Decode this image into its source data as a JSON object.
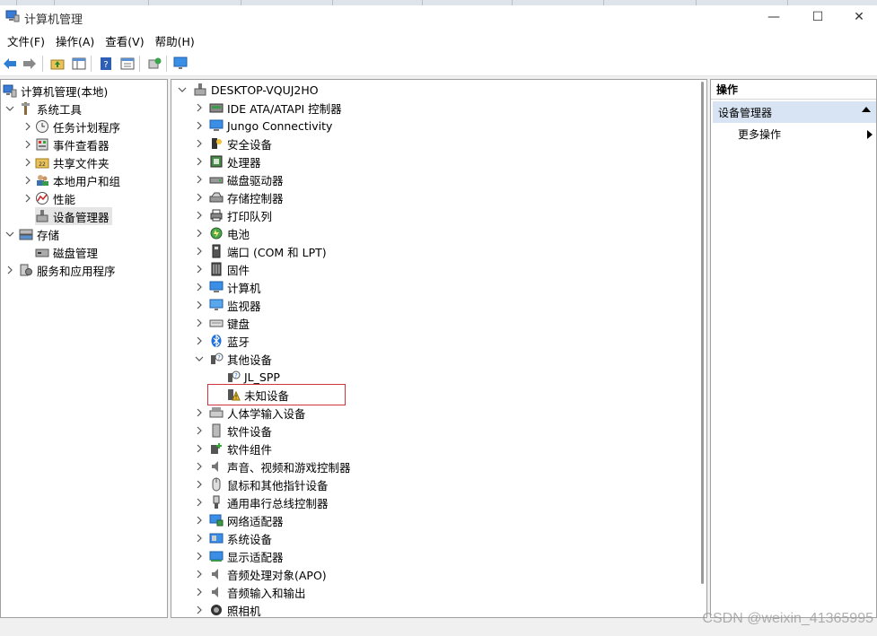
{
  "window": {
    "title": "计算机管理"
  },
  "menu": [
    "文件(F)",
    "操作(A)",
    "查看(V)",
    "帮助(H)"
  ],
  "toolbar_icons": [
    "back-arrow-icon",
    "forward-arrow-icon",
    "up-folder-icon",
    "show-hide-tree-icon",
    "help-icon",
    "properties-icon",
    "update-driver-icon",
    "monitor-icon"
  ],
  "left_tree": [
    {
      "label": "计算机管理(本地)",
      "icon": "computer-management-icon",
      "level": 0,
      "chevron": "",
      "selected": false
    },
    {
      "label": "系统工具",
      "icon": "tools-icon",
      "level": 0,
      "chevron": "down",
      "selected": false
    },
    {
      "label": "任务计划程序",
      "icon": "clock-icon",
      "level": 1,
      "chevron": "right",
      "selected": false
    },
    {
      "label": "事件查看器",
      "icon": "event-viewer-icon",
      "level": 1,
      "chevron": "right",
      "selected": false
    },
    {
      "label": "共享文件夹",
      "icon": "shared-folder-icon",
      "level": 1,
      "chevron": "right",
      "selected": false
    },
    {
      "label": "本地用户和组",
      "icon": "users-icon",
      "level": 1,
      "chevron": "right",
      "selected": false
    },
    {
      "label": "性能",
      "icon": "performance-icon",
      "level": 1,
      "chevron": "right",
      "selected": false
    },
    {
      "label": "设备管理器",
      "icon": "device-manager-icon",
      "level": 1,
      "chevron": "",
      "selected": true
    },
    {
      "label": "存储",
      "icon": "storage-icon",
      "level": 0,
      "chevron": "down",
      "selected": false
    },
    {
      "label": "磁盘管理",
      "icon": "disk-management-icon",
      "level": 1,
      "chevron": "",
      "selected": false
    },
    {
      "label": "服务和应用程序",
      "icon": "services-icon",
      "level": 0,
      "chevron": "right",
      "selected": false
    }
  ],
  "device_tree": {
    "root": "DESKTOP-VQUJ2HO",
    "items": [
      {
        "label": "IDE ATA/ATAPI 控制器",
        "icon": "ide-controller-icon",
        "level": 1,
        "chevron": "right"
      },
      {
        "label": "Jungo Connectivity",
        "icon": "jungo-icon",
        "level": 1,
        "chevron": "right"
      },
      {
        "label": "安全设备",
        "icon": "security-key-icon",
        "level": 1,
        "chevron": "right"
      },
      {
        "label": "处理器",
        "icon": "processor-icon",
        "level": 1,
        "chevron": "right"
      },
      {
        "label": "磁盘驱动器",
        "icon": "disk-drive-icon",
        "level": 1,
        "chevron": "right"
      },
      {
        "label": "存储控制器",
        "icon": "storage-controller-icon",
        "level": 1,
        "chevron": "right"
      },
      {
        "label": "打印队列",
        "icon": "printer-icon",
        "level": 1,
        "chevron": "right"
      },
      {
        "label": "电池",
        "icon": "battery-icon",
        "level": 1,
        "chevron": "right"
      },
      {
        "label": "端口 (COM 和 LPT)",
        "icon": "port-icon",
        "level": 1,
        "chevron": "right"
      },
      {
        "label": "固件",
        "icon": "firmware-icon",
        "level": 1,
        "chevron": "right"
      },
      {
        "label": "计算机",
        "icon": "computer-icon",
        "level": 1,
        "chevron": "right"
      },
      {
        "label": "监视器",
        "icon": "monitor-icon",
        "level": 1,
        "chevron": "right"
      },
      {
        "label": "键盘",
        "icon": "keyboard-icon",
        "level": 1,
        "chevron": "right"
      },
      {
        "label": "蓝牙",
        "icon": "bluetooth-icon",
        "level": 1,
        "chevron": "right"
      },
      {
        "label": "其他设备",
        "icon": "other-devices-icon",
        "level": 1,
        "chevron": "down"
      },
      {
        "label": "JL_SPP",
        "icon": "unknown-device-icon",
        "level": 2,
        "chevron": ""
      },
      {
        "label": "未知设备",
        "icon": "warning-device-icon",
        "level": 2,
        "chevron": ""
      },
      {
        "label": "人体学输入设备",
        "icon": "hid-icon",
        "level": 1,
        "chevron": "right"
      },
      {
        "label": "软件设备",
        "icon": "software-device-icon",
        "level": 1,
        "chevron": "right"
      },
      {
        "label": "软件组件",
        "icon": "software-component-icon",
        "level": 1,
        "chevron": "right"
      },
      {
        "label": "声音、视频和游戏控制器",
        "icon": "sound-icon",
        "level": 1,
        "chevron": "right"
      },
      {
        "label": "鼠标和其他指针设备",
        "icon": "mouse-icon",
        "level": 1,
        "chevron": "right"
      },
      {
        "label": "通用串行总线控制器",
        "icon": "usb-icon",
        "level": 1,
        "chevron": "right"
      },
      {
        "label": "网络适配器",
        "icon": "network-adapter-icon",
        "level": 1,
        "chevron": "right"
      },
      {
        "label": "系统设备",
        "icon": "system-device-icon",
        "level": 1,
        "chevron": "right"
      },
      {
        "label": "显示适配器",
        "icon": "display-adapter-icon",
        "level": 1,
        "chevron": "right"
      },
      {
        "label": "音频处理对象(APO)",
        "icon": "audio-apo-icon",
        "level": 1,
        "chevron": "right"
      },
      {
        "label": "音频输入和输出",
        "icon": "audio-io-icon",
        "level": 1,
        "chevron": "right"
      },
      {
        "label": "照相机",
        "icon": "camera-icon",
        "level": 1,
        "chevron": "right"
      }
    ]
  },
  "actions_pane": {
    "header": "操作",
    "section": "设备管理器",
    "item": "更多操作"
  },
  "watermark": "CSDN @weixin_41365995",
  "colors": {
    "selection_bg": "#e5e5e5",
    "section_bg": "#d8e4f3",
    "highlight_border": "#d0343a"
  }
}
